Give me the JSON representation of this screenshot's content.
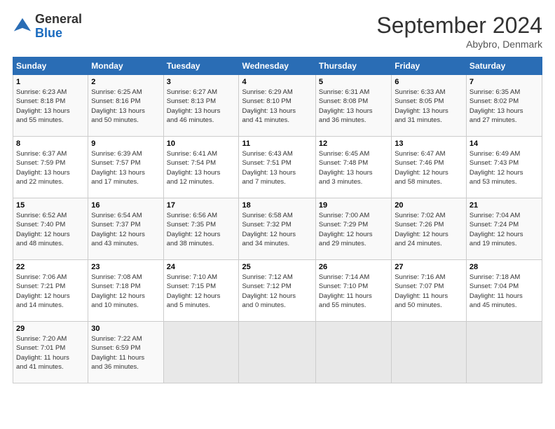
{
  "header": {
    "logo_general": "General",
    "logo_blue": "Blue",
    "month_title": "September 2024",
    "location": "Abybro, Denmark"
  },
  "weekdays": [
    "Sunday",
    "Monday",
    "Tuesday",
    "Wednesday",
    "Thursday",
    "Friday",
    "Saturday"
  ],
  "weeks": [
    [
      {
        "day": "1",
        "info": "Sunrise: 6:23 AM\nSunset: 8:18 PM\nDaylight: 13 hours\nand 55 minutes."
      },
      {
        "day": "2",
        "info": "Sunrise: 6:25 AM\nSunset: 8:16 PM\nDaylight: 13 hours\nand 50 minutes."
      },
      {
        "day": "3",
        "info": "Sunrise: 6:27 AM\nSunset: 8:13 PM\nDaylight: 13 hours\nand 46 minutes."
      },
      {
        "day": "4",
        "info": "Sunrise: 6:29 AM\nSunset: 8:10 PM\nDaylight: 13 hours\nand 41 minutes."
      },
      {
        "day": "5",
        "info": "Sunrise: 6:31 AM\nSunset: 8:08 PM\nDaylight: 13 hours\nand 36 minutes."
      },
      {
        "day": "6",
        "info": "Sunrise: 6:33 AM\nSunset: 8:05 PM\nDaylight: 13 hours\nand 31 minutes."
      },
      {
        "day": "7",
        "info": "Sunrise: 6:35 AM\nSunset: 8:02 PM\nDaylight: 13 hours\nand 27 minutes."
      }
    ],
    [
      {
        "day": "8",
        "info": "Sunrise: 6:37 AM\nSunset: 7:59 PM\nDaylight: 13 hours\nand 22 minutes."
      },
      {
        "day": "9",
        "info": "Sunrise: 6:39 AM\nSunset: 7:57 PM\nDaylight: 13 hours\nand 17 minutes."
      },
      {
        "day": "10",
        "info": "Sunrise: 6:41 AM\nSunset: 7:54 PM\nDaylight: 13 hours\nand 12 minutes."
      },
      {
        "day": "11",
        "info": "Sunrise: 6:43 AM\nSunset: 7:51 PM\nDaylight: 13 hours\nand 7 minutes."
      },
      {
        "day": "12",
        "info": "Sunrise: 6:45 AM\nSunset: 7:48 PM\nDaylight: 13 hours\nand 3 minutes."
      },
      {
        "day": "13",
        "info": "Sunrise: 6:47 AM\nSunset: 7:46 PM\nDaylight: 12 hours\nand 58 minutes."
      },
      {
        "day": "14",
        "info": "Sunrise: 6:49 AM\nSunset: 7:43 PM\nDaylight: 12 hours\nand 53 minutes."
      }
    ],
    [
      {
        "day": "15",
        "info": "Sunrise: 6:52 AM\nSunset: 7:40 PM\nDaylight: 12 hours\nand 48 minutes."
      },
      {
        "day": "16",
        "info": "Sunrise: 6:54 AM\nSunset: 7:37 PM\nDaylight: 12 hours\nand 43 minutes."
      },
      {
        "day": "17",
        "info": "Sunrise: 6:56 AM\nSunset: 7:35 PM\nDaylight: 12 hours\nand 38 minutes."
      },
      {
        "day": "18",
        "info": "Sunrise: 6:58 AM\nSunset: 7:32 PM\nDaylight: 12 hours\nand 34 minutes."
      },
      {
        "day": "19",
        "info": "Sunrise: 7:00 AM\nSunset: 7:29 PM\nDaylight: 12 hours\nand 29 minutes."
      },
      {
        "day": "20",
        "info": "Sunrise: 7:02 AM\nSunset: 7:26 PM\nDaylight: 12 hours\nand 24 minutes."
      },
      {
        "day": "21",
        "info": "Sunrise: 7:04 AM\nSunset: 7:24 PM\nDaylight: 12 hours\nand 19 minutes."
      }
    ],
    [
      {
        "day": "22",
        "info": "Sunrise: 7:06 AM\nSunset: 7:21 PM\nDaylight: 12 hours\nand 14 minutes."
      },
      {
        "day": "23",
        "info": "Sunrise: 7:08 AM\nSunset: 7:18 PM\nDaylight: 12 hours\nand 10 minutes."
      },
      {
        "day": "24",
        "info": "Sunrise: 7:10 AM\nSunset: 7:15 PM\nDaylight: 12 hours\nand 5 minutes."
      },
      {
        "day": "25",
        "info": "Sunrise: 7:12 AM\nSunset: 7:12 PM\nDaylight: 12 hours\nand 0 minutes."
      },
      {
        "day": "26",
        "info": "Sunrise: 7:14 AM\nSunset: 7:10 PM\nDaylight: 11 hours\nand 55 minutes."
      },
      {
        "day": "27",
        "info": "Sunrise: 7:16 AM\nSunset: 7:07 PM\nDaylight: 11 hours\nand 50 minutes."
      },
      {
        "day": "28",
        "info": "Sunrise: 7:18 AM\nSunset: 7:04 PM\nDaylight: 11 hours\nand 45 minutes."
      }
    ],
    [
      {
        "day": "29",
        "info": "Sunrise: 7:20 AM\nSunset: 7:01 PM\nDaylight: 11 hours\nand 41 minutes."
      },
      {
        "day": "30",
        "info": "Sunrise: 7:22 AM\nSunset: 6:59 PM\nDaylight: 11 hours\nand 36 minutes."
      },
      {
        "day": "",
        "info": ""
      },
      {
        "day": "",
        "info": ""
      },
      {
        "day": "",
        "info": ""
      },
      {
        "day": "",
        "info": ""
      },
      {
        "day": "",
        "info": ""
      }
    ]
  ]
}
